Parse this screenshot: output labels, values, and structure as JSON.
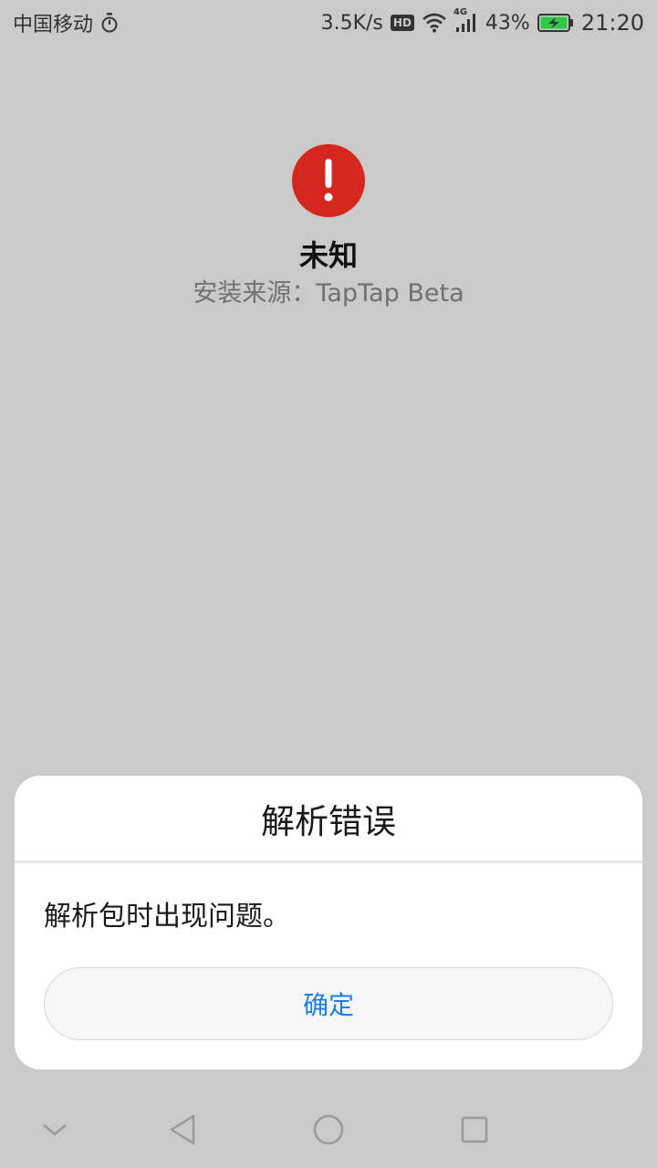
{
  "status_bar": {
    "carrier": "中国移动",
    "net_speed": "3.5K/s",
    "hd_label": "HD",
    "network_type": "4G",
    "battery_percent": "43%",
    "time": "21:20",
    "icons": [
      "timer-icon",
      "wifi-icon",
      "signal-icon",
      "battery-charging-icon"
    ]
  },
  "app": {
    "name": "未知",
    "install_source": "安装来源：TapTap Beta",
    "icon": "error-exclamation-icon",
    "icon_color": "#d4281e"
  },
  "dialog": {
    "title": "解析错误",
    "message": "解析包时出现问题。",
    "confirm_label": "确定",
    "accent_color": "#1a7fe6"
  },
  "nav_bar": {
    "icons": [
      "collapse-chevron-icon",
      "back-icon",
      "home-icon",
      "recents-icon"
    ]
  }
}
